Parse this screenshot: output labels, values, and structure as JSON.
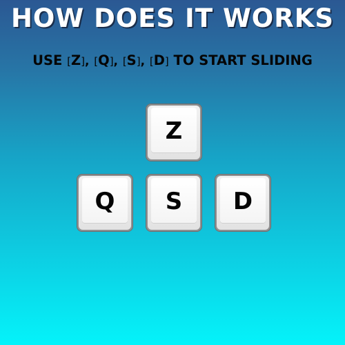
{
  "title": "HOW DOES IT WORKS",
  "instructions": {
    "prefix": "USE",
    "keys": [
      "Z",
      "Q",
      "S",
      "D"
    ],
    "suffix": "TO START SLIDING"
  },
  "keys": [
    {
      "id": "z",
      "label": "Z"
    },
    {
      "id": "q",
      "label": "Q"
    },
    {
      "id": "s",
      "label": "S"
    },
    {
      "id": "d",
      "label": "D"
    }
  ],
  "colors": {
    "background_top": "#2b5893",
    "background_bottom": "#04f3fa",
    "title": "#ffffff",
    "text": "#050505",
    "key_face": "#f2f2f2",
    "key_border": "#8f9091"
  }
}
